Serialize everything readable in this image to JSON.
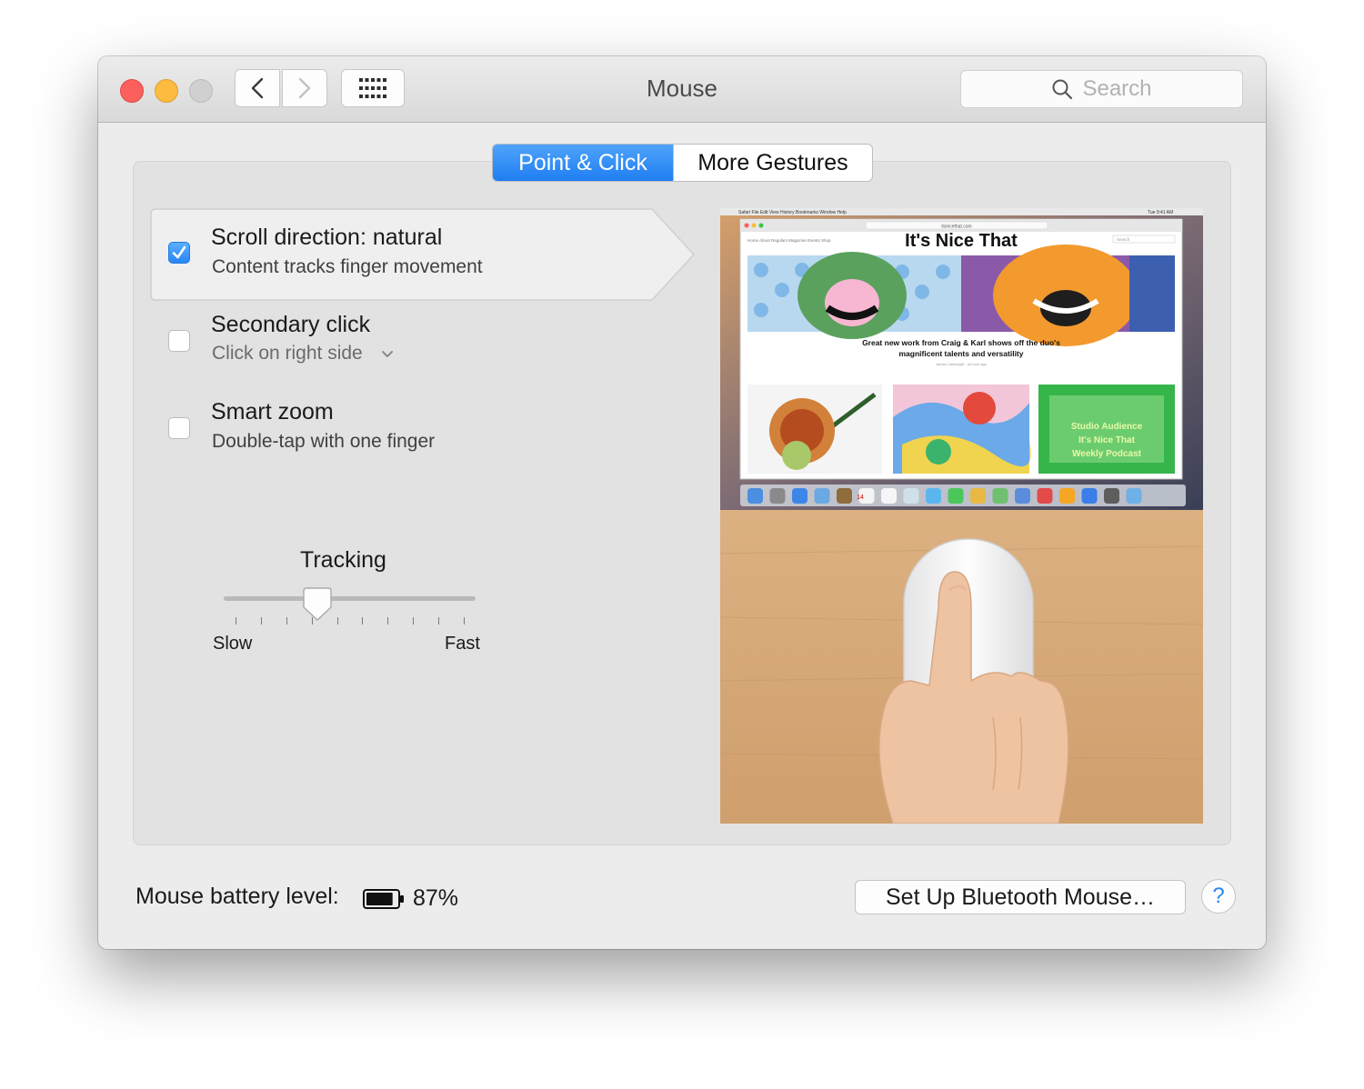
{
  "window": {
    "title": "Mouse"
  },
  "toolbar": {
    "search_placeholder": "Search"
  },
  "tabs": [
    {
      "label": "Point & Click",
      "active": true
    },
    {
      "label": "More Gestures",
      "active": false
    }
  ],
  "options": [
    {
      "title": "Scroll direction: natural",
      "subtitle": "Content tracks finger movement",
      "checked": true,
      "selected": true
    },
    {
      "title": "Secondary click",
      "subtitle": "Click on right side",
      "checked": false,
      "has_dropdown": true
    },
    {
      "title": "Smart zoom",
      "subtitle": "Double-tap with one finger",
      "checked": false
    }
  ],
  "tracking": {
    "label": "Tracking",
    "min_label": "Slow",
    "max_label": "Fast",
    "value_fraction": 0.36,
    "ticks": 10
  },
  "preview": {
    "site_title": "It's Nice That",
    "url": "itsnicethat.com",
    "menubar": [
      "Safari",
      "File",
      "Edit",
      "View",
      "History",
      "Bookmarks",
      "Window",
      "Help"
    ],
    "clock": "Tue 9:41 AM",
    "site_nav": [
      "Home",
      "About",
      "Regulars",
      "Magazine",
      "Events",
      "Shop"
    ],
    "search_label": "Search",
    "headline_1": "Great new work from Craig & Karl shows off the duo's",
    "headline_2": "magnificent talents and versatility",
    "byline": "James Cartwright · an hour ago",
    "podcast_1": "Studio Audience",
    "podcast_2": "It's Nice That",
    "podcast_3": "Weekly Podcast",
    "calendar_day": "14"
  },
  "footer": {
    "battery_label": "Mouse battery level:",
    "battery_percent": "87%",
    "battery_level": 0.87,
    "setup_button": "Set Up Bluetooth Mouse…",
    "help_button": "?"
  },
  "colors": {
    "accent": "#2a86f5",
    "close": "#fc605c",
    "minimize": "#fdbc40",
    "zoom_disabled": "#d0d0d0"
  },
  "icons": [
    "close-icon",
    "minimize-icon",
    "zoom-icon",
    "chevron-left-icon",
    "chevron-right-icon",
    "grid-icon",
    "search-icon",
    "checkmark-icon",
    "chevron-down-icon",
    "battery-icon",
    "help-icon"
  ]
}
